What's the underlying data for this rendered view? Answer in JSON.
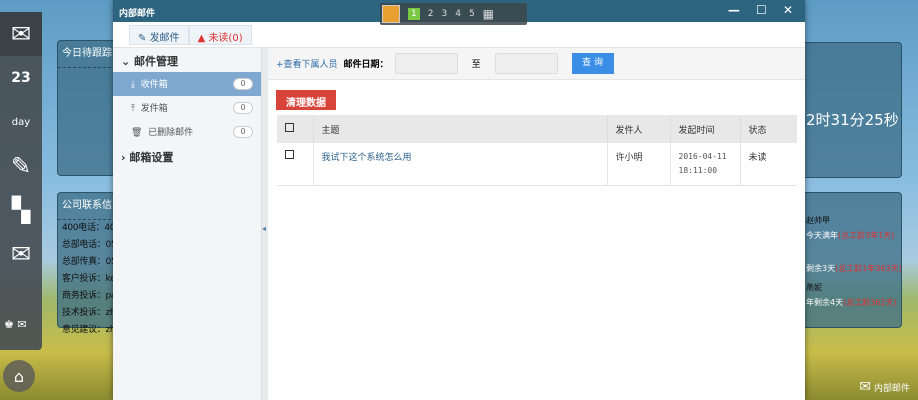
{
  "window": {
    "title": "内部邮件",
    "controls": "— ☐ ✕"
  },
  "toolbar": {
    "compose": "发邮件",
    "unread": "未读(0)"
  },
  "sidebar": {
    "group1": "邮件管理",
    "items": [
      {
        "label": "收件箱",
        "count": "0"
      },
      {
        "label": "发件箱",
        "count": "0"
      },
      {
        "label": "已删除邮件",
        "count": "0"
      }
    ],
    "group2": "邮箱设置"
  },
  "filter": {
    "subordinates": "+查看下属人员",
    "date_label": "邮件日期：",
    "to": "至",
    "query": "查 询"
  },
  "clear_button": "清理数据",
  "table": {
    "headers": [
      "主题",
      "发件人",
      "发起时间",
      "状态"
    ],
    "rows": [
      {
        "subject": "我试下这个系统怎么用",
        "sender": "许小明",
        "date": "2016-04-11",
        "time": "18:11:00",
        "status": "未读"
      }
    ]
  },
  "taskbar": {
    "pages": [
      "1",
      "2",
      "3",
      "4",
      "5"
    ]
  },
  "background": {
    "panel1_title": "今日待跟踪",
    "timer": "2时31分25秒",
    "panel2_title": "公司联系信...",
    "contacts": [
      "400电话：40",
      "总部电话：05",
      "总部传真：05",
      "客户投诉：ke",
      "商务投诉：pa",
      "技术投诉：zh",
      "意见建议：zh"
    ],
    "right_lines": [
      "赵帅甲",
      "今天满年",
      "(总工龄3年1天)",
      "剩余3天",
      "(总工龄1年363天)",
      "燕妮",
      "年剩余4天",
      "(总工龄362天)"
    ]
  },
  "notification": "内部邮件"
}
